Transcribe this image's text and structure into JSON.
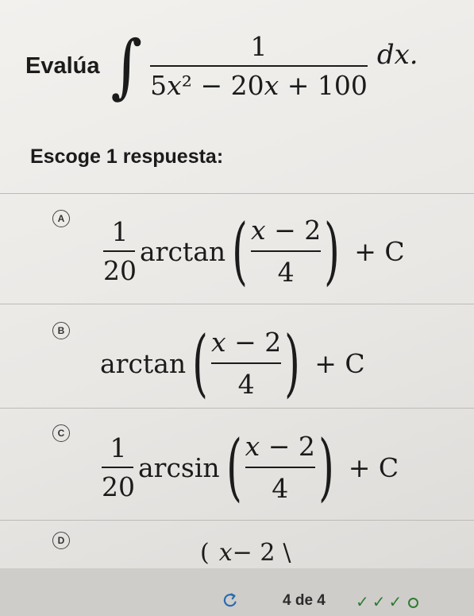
{
  "question": {
    "lead": "Evalúa",
    "integral_sign": "∫",
    "numerator": "1",
    "denominator_parts": [
      "5",
      "x",
      "² − 20",
      "x",
      " + 100"
    ],
    "differential": "dx."
  },
  "prompt": "Escoge 1 respuesta:",
  "options": [
    {
      "letter": "A",
      "coef_num": "1",
      "coef_den": "20",
      "function": "arctan",
      "inner_num_var": "x",
      "inner_num_rest": " − 2",
      "inner_den": "4",
      "left_paren": "(",
      "right_paren": ")",
      "tail": "+ C"
    },
    {
      "letter": "B",
      "function": "arctan",
      "inner_num_var": "x",
      "inner_num_rest": " − 2",
      "inner_den": "4",
      "left_paren": "(",
      "right_paren": ")",
      "tail": "+ C"
    },
    {
      "letter": "C",
      "coef_num": "1",
      "coef_den": "20",
      "function": "arcsin",
      "inner_num_var": "x",
      "inner_num_rest": " − 2",
      "inner_den": "4",
      "left_paren": "(",
      "right_paren": ")",
      "tail": "+ C"
    },
    {
      "letter": "D",
      "visible_text": "(",
      "inner_num_var": "x",
      "inner_num_rest": " − 2",
      "right_paren": "\\"
    }
  ],
  "footer": {
    "icon": "retry-icon",
    "progress_label": "4 de 4",
    "progress_marks": [
      "✓",
      "✓",
      "✓"
    ],
    "accent_color": "#2e7d32"
  }
}
